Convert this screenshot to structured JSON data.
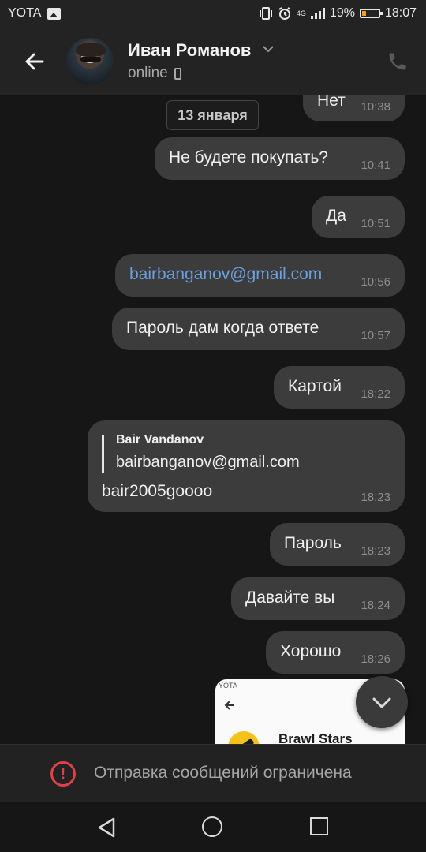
{
  "status_bar": {
    "carrier": "YOTA",
    "network": "4G",
    "battery": "19%",
    "time": "18:07"
  },
  "header": {
    "contact_name": "Иван Романов",
    "presence": "online"
  },
  "messages": {
    "date_separator": "13 января",
    "items": [
      {
        "text": "Нет",
        "time": "10:38"
      },
      {
        "text": "Не будете покупать?",
        "time": "10:41"
      },
      {
        "text": "Да",
        "time": "10:51"
      },
      {
        "text": "bairbanganov@gmail.com",
        "time": "10:56"
      },
      {
        "text": "Пароль дам когда ответе",
        "time": "10:57"
      },
      {
        "text": "Картой",
        "time": "18:22"
      },
      {
        "text": "bair2005goooo",
        "time": "18:23",
        "quote_author": "Bair Vandanov",
        "quote_text": "bairbanganov@gmail.com"
      },
      {
        "text": "Пароль",
        "time": "18:23"
      },
      {
        "text": "Давайте вы",
        "time": "18:24"
      },
      {
        "text": "Хорошо",
        "time": "18:26"
      }
    ],
    "preview": {
      "status_text": "YOTA",
      "app_title": "Brawl Stars"
    }
  },
  "footer": {
    "restriction_text": "Отправка сообщений ограничена",
    "warning_glyph": "!"
  },
  "colors": {
    "background": "#161616",
    "bubble": "#3c3c3c",
    "link": "#6a9fe0",
    "warning": "#e0404a"
  }
}
